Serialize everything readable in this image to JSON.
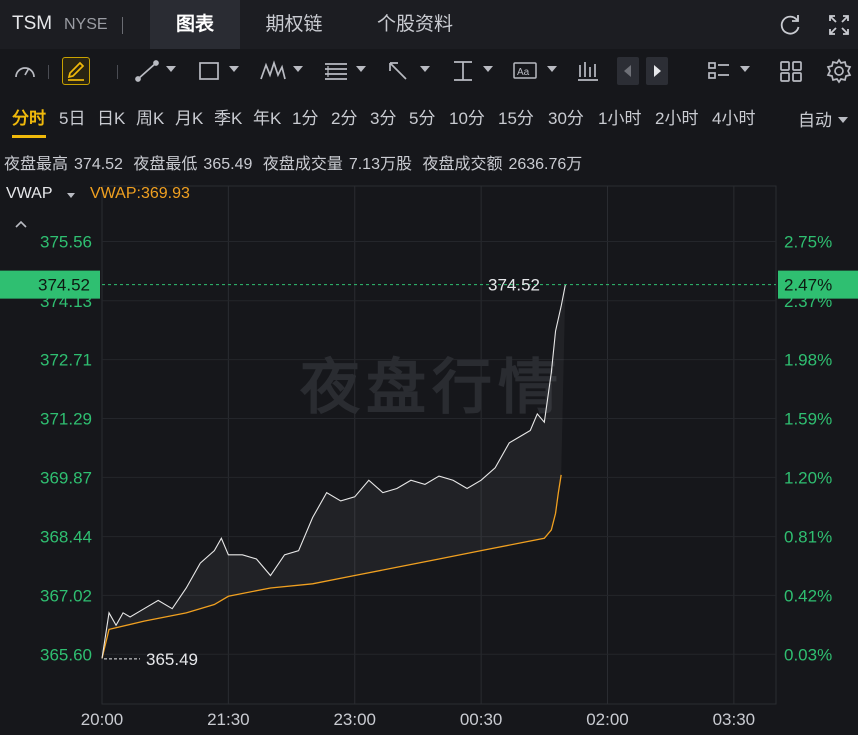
{
  "header": {
    "symbol": "TSM",
    "exchange": "NYSE",
    "tabs": [
      "图表",
      "期权链",
      "个股资料"
    ],
    "active_tab": 0
  },
  "periods": {
    "items": [
      "分时",
      "5日",
      "日K",
      "周K",
      "月K",
      "季K",
      "年K",
      "1分",
      "2分",
      "3分",
      "5分",
      "10分",
      "15分",
      "30分",
      "1小时",
      "2小时",
      "4小时"
    ],
    "active": 0,
    "auto_label": "自动"
  },
  "stats": [
    {
      "label": "夜盘最高",
      "value": "374.52"
    },
    {
      "label": "夜盘最低",
      "value": "365.49"
    },
    {
      "label": "夜盘成交量",
      "value": "7.13万股"
    },
    {
      "label": "夜盘成交额",
      "value": "2636.76万"
    }
  ],
  "indicator": {
    "name": "VWAP",
    "value_label": "VWAP:369.93"
  },
  "icons": [
    "refresh-icon",
    "fullscreen-icon",
    "gauge-icon",
    "pencil-icon",
    "trend-line-icon",
    "rectangle-icon",
    "pattern-icon",
    "fib-icon",
    "arrow-icon",
    "measure-icon",
    "text-icon",
    "bar-chart-icon",
    "prev-icon",
    "next-icon",
    "layout-icon",
    "grid-icon",
    "gear-icon"
  ],
  "colors": {
    "up": "#2fbf71",
    "price_line": "#e8e8e8",
    "vwap": "#f0a020",
    "accent": "#f0b90b"
  },
  "chart_data": {
    "type": "line",
    "watermark": "夜盘行情",
    "x_ticks": [
      "20:00",
      "21:30",
      "23:00",
      "00:30",
      "02:00",
      "03:30"
    ],
    "xlim": [
      "20:00",
      "04:00"
    ],
    "y_ticks": [
      "375.56",
      "374.13",
      "372.71",
      "371.29",
      "369.87",
      "368.44",
      "367.02",
      "365.60"
    ],
    "pct_ticks": [
      "2.75%",
      "2.37%",
      "1.98%",
      "1.59%",
      "1.20%",
      "0.81%",
      "0.42%",
      "0.03%"
    ],
    "ylim": [
      364.4,
      376.9
    ],
    "current_price": "374.52",
    "current_pct": "2.47%",
    "high_label": "374.52",
    "low_label": "365.49",
    "series": [
      {
        "name": "Price",
        "x": [
          "20:00",
          "20:05",
          "20:10",
          "20:15",
          "20:20",
          "20:30",
          "20:40",
          "20:50",
          "21:00",
          "21:10",
          "21:20",
          "21:25",
          "21:30",
          "21:40",
          "21:50",
          "22:00",
          "22:10",
          "22:20",
          "22:30",
          "22:40",
          "22:50",
          "23:00",
          "23:10",
          "23:20",
          "23:30",
          "23:40",
          "23:50",
          "00:00",
          "00:10",
          "00:20",
          "00:30",
          "00:40",
          "00:50",
          "01:00",
          "01:05",
          "01:10",
          "01:15",
          "01:20",
          "01:23",
          "01:27",
          "01:30"
        ],
        "values": [
          365.5,
          366.6,
          366.3,
          366.6,
          366.5,
          366.7,
          366.9,
          366.7,
          367.2,
          367.8,
          368.1,
          368.4,
          368.0,
          368.0,
          367.9,
          367.5,
          368.0,
          368.1,
          368.9,
          369.5,
          369.3,
          369.4,
          369.8,
          369.5,
          369.6,
          369.8,
          369.7,
          369.9,
          369.8,
          369.6,
          369.8,
          370.1,
          370.7,
          370.9,
          371.0,
          371.4,
          371.2,
          372.4,
          373.4,
          374.0,
          374.52
        ]
      },
      {
        "name": "VWAP",
        "x": [
          "20:00",
          "20:05",
          "20:30",
          "21:00",
          "21:20",
          "21:30",
          "22:00",
          "22:30",
          "23:00",
          "23:30",
          "00:00",
          "00:30",
          "01:00",
          "01:15",
          "01:20",
          "01:23",
          "01:25",
          "01:27"
        ],
        "values": [
          365.5,
          366.2,
          366.4,
          366.6,
          366.8,
          367.0,
          367.2,
          367.3,
          367.5,
          367.7,
          367.9,
          368.1,
          368.3,
          368.4,
          368.6,
          369.0,
          369.5,
          369.93
        ]
      }
    ]
  }
}
